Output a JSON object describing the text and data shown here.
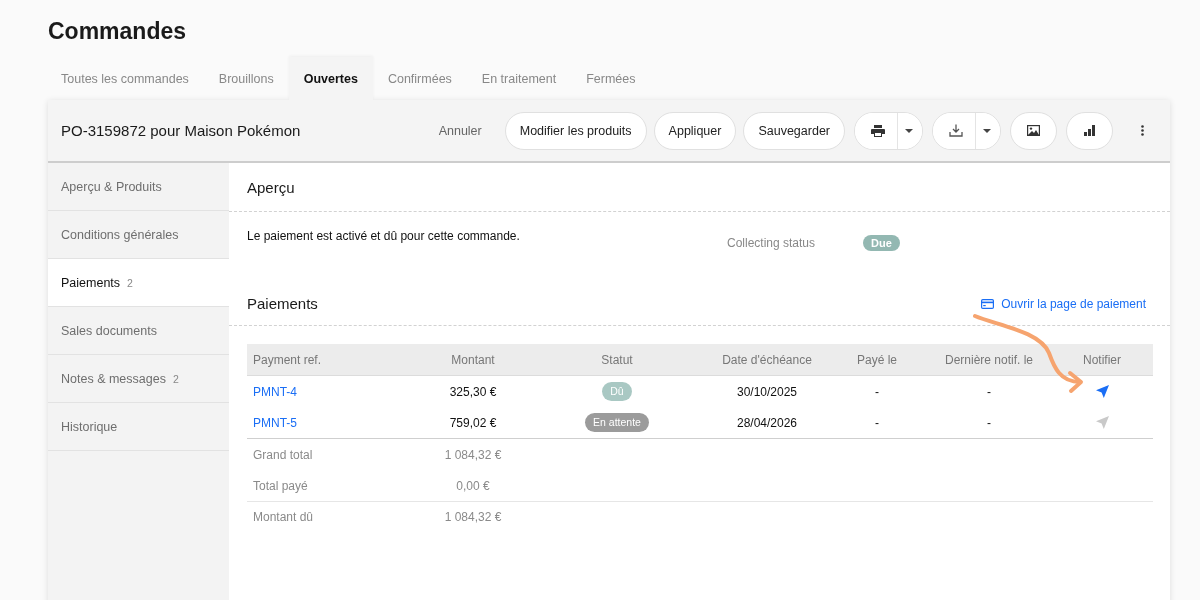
{
  "page": {
    "title": "Commandes"
  },
  "tabs": [
    {
      "label": "Toutes les commandes",
      "selected": false
    },
    {
      "label": "Brouillons",
      "selected": false
    },
    {
      "label": "Ouvertes",
      "selected": true
    },
    {
      "label": "Confirmées",
      "selected": false
    },
    {
      "label": "En traitement",
      "selected": false
    },
    {
      "label": "Fermées",
      "selected": false
    }
  ],
  "order": {
    "title": "PO-3159872 pour Maison Pokémon",
    "actions": [
      {
        "kind": "plain",
        "label": "Annuler"
      },
      {
        "kind": "pill",
        "label": "Modifier les produits"
      },
      {
        "kind": "pill",
        "label": "Appliquer"
      },
      {
        "kind": "pill",
        "label": "Sauvegarder"
      }
    ]
  },
  "sidebar": {
    "items": [
      {
        "label": "Aperçu & Produits",
        "selected": false
      },
      {
        "label": "Conditions générales",
        "selected": false
      },
      {
        "label": "Paiements",
        "count": "2",
        "selected": true
      },
      {
        "label": "Sales documents",
        "selected": false
      },
      {
        "label": "Notes & messages",
        "count": "2",
        "selected": false
      },
      {
        "label": "Historique",
        "selected": false
      }
    ]
  },
  "overview": {
    "heading": "Aperçu",
    "message": "Le paiement est activé et dû pour cette commande.",
    "collecting_status": {
      "label": "Collecting status",
      "value": "Due"
    }
  },
  "payments": {
    "heading": "Paiements",
    "link": "Ouvrir la page de paiement",
    "columns": [
      "Payment ref.",
      "Montant",
      "Statut",
      "Date d'échéance",
      "Payé le",
      "Dernière notif. le",
      "Notifier"
    ],
    "rows": [
      {
        "ref": "PMNT-4",
        "amount": "325,30 €",
        "status": {
          "label": "Dû",
          "color": "#a9c8c3"
        },
        "due_date": "30/10/2025",
        "paid_on": "-",
        "last_notified": "-",
        "notify_disabled": false
      },
      {
        "ref": "PMNT-5",
        "amount": "759,02 €",
        "status": {
          "label": "En attente",
          "color": "#9b9b9b"
        },
        "due_date": "28/04/2026",
        "paid_on": "-",
        "last_notified": "-",
        "notify_disabled": true
      }
    ],
    "totals": [
      {
        "label": "Grand total",
        "value": "1 084,32 €"
      },
      {
        "label": "Total payé",
        "value": "0,00 €"
      },
      {
        "label": "Montant dû",
        "value": "1 084,32 €"
      }
    ]
  }
}
